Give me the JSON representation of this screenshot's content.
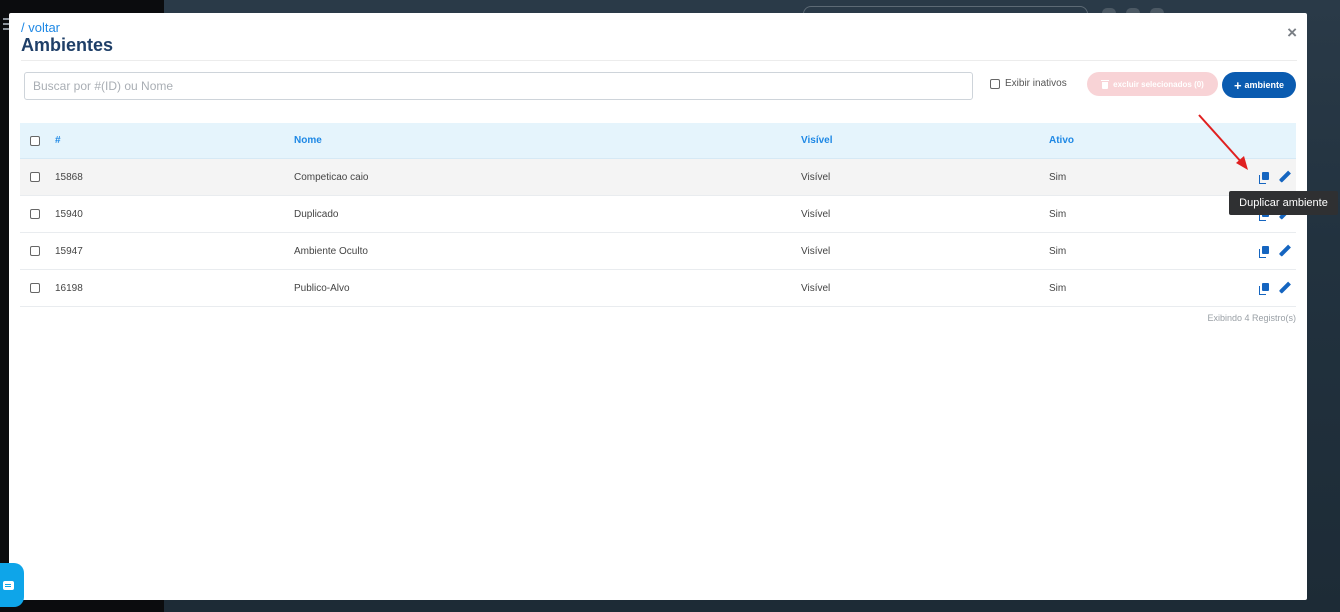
{
  "header": {
    "back_link": "/ voltar",
    "title": "Ambientes",
    "close": "×"
  },
  "toolbar": {
    "search_placeholder": "Buscar por #(ID) ou Nome",
    "show_inactive_label": "Exibir inativos",
    "delete_selected_label": "excluir selecionados (0)",
    "add_label": "ambiente"
  },
  "table": {
    "columns": [
      "#",
      "Nome",
      "Visível",
      "Ativo"
    ],
    "rows": [
      {
        "id": "15868",
        "name": "Competicao caio",
        "visible": "Visível",
        "active": "Sim"
      },
      {
        "id": "15940",
        "name": "Duplicado",
        "visible": "Visível",
        "active": "Sim"
      },
      {
        "id": "15947",
        "name": "Ambiente Oculto",
        "visible": "Visível",
        "active": "Sim"
      },
      {
        "id": "16198",
        "name": "Publico-Alvo",
        "visible": "Visível",
        "active": "Sim"
      }
    ],
    "footer": "Exibindo 4 Registro(s)"
  },
  "tooltip": "Duplicar ambiente",
  "colors": {
    "primary": "#0a5bb0",
    "link": "#1e88e5",
    "title": "#1f3f68",
    "header_bg": "#e5f4fc",
    "danger_disabled": "#f8d3d6",
    "annotation_arrow": "#e02020"
  }
}
